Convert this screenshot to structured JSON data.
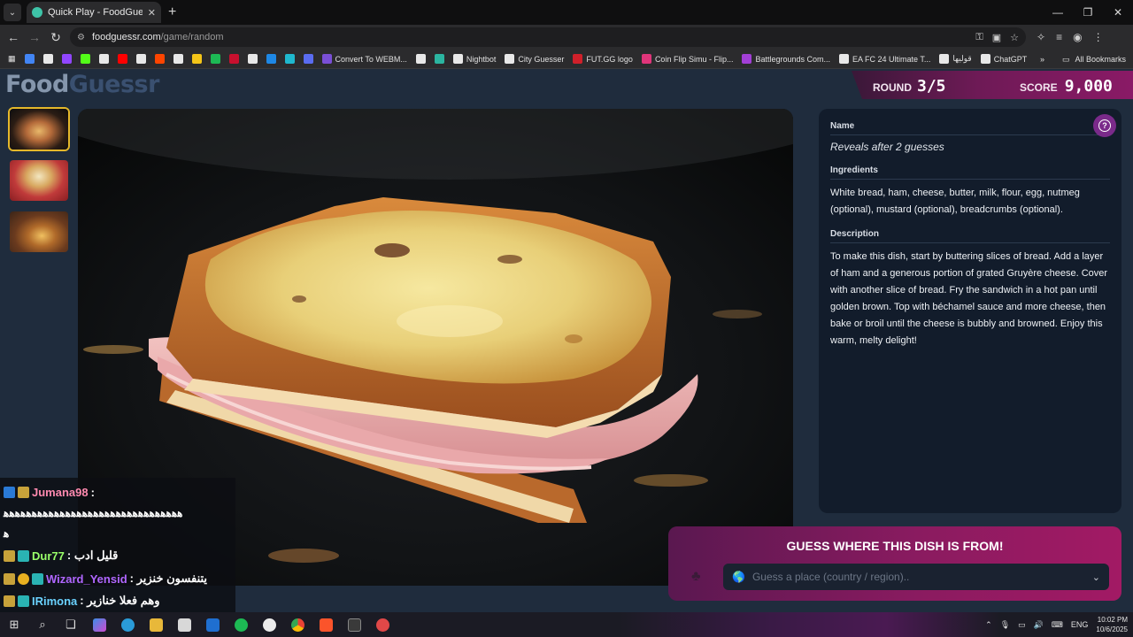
{
  "browser": {
    "tab_title": "Quick Play - FoodGuessr | Food",
    "url_host": "foodguessr.com",
    "url_path": "/game/random",
    "bookmarks": [
      {
        "label": "",
        "color": "#4285f4"
      },
      {
        "label": "",
        "color": "#e8e8e8"
      },
      {
        "label": "",
        "color": "#9146ff"
      },
      {
        "label": "",
        "color": "#53fc18"
      },
      {
        "label": "",
        "color": "#e8e8e8"
      },
      {
        "label": "",
        "color": "#ff0000"
      },
      {
        "label": "",
        "color": "#e8e8e8"
      },
      {
        "label": "",
        "color": "#ff4500"
      },
      {
        "label": "",
        "color": "#e8e8e8"
      },
      {
        "label": "",
        "color": "#f5c518"
      },
      {
        "label": "",
        "color": "#1db954"
      },
      {
        "label": "",
        "color": "#c8102e"
      },
      {
        "label": "",
        "color": "#e8e8e8"
      },
      {
        "label": "",
        "color": "#1e88e5"
      },
      {
        "label": "",
        "color": "#1fb8cd"
      },
      {
        "label": "",
        "color": "#5a6cf0"
      },
      {
        "label": "Convert To WEBM...",
        "color": "#7a4fd6"
      },
      {
        "label": "",
        "color": "#e8e8e8"
      },
      {
        "label": "",
        "color": "#2bb5a0"
      },
      {
        "label": "Nightbot",
        "color": "#e8e8e8"
      },
      {
        "label": "City Guesser",
        "color": "#e8e8e8"
      },
      {
        "label": "FUT.GG logo",
        "color": "#d0202a"
      },
      {
        "label": "Coin Flip Simu - Flip...",
        "color": "#e0357a"
      },
      {
        "label": "Battlegrounds Com...",
        "color": "#a23fd6"
      },
      {
        "label": "EA FC 24 Ultimate T...",
        "color": "#e8e8e8"
      },
      {
        "label": "قوليها",
        "color": "#e8e8e8"
      },
      {
        "label": "ChatGPT",
        "color": "#e8e8e8"
      }
    ],
    "all_bookmarks": "All Bookmarks"
  },
  "game": {
    "logo_part1": "Food",
    "logo_part2": "Guessr",
    "round_label": "ROUND",
    "round_value": "3/5",
    "score_label": "SCORE",
    "score_value": "9,000",
    "name_heading": "Name",
    "name_value": "Reveals after 2 guesses",
    "ingredients_heading": "Ingredients",
    "ingredients_text": "White bread, ham, cheese, butter, milk, flour, egg, nutmeg (optional), mustard (optional), breadcrumbs (optional).",
    "description_heading": "Description",
    "description_text": "To make this dish, start by buttering slices of bread. Add a layer of ham and a generous portion of grated Gruyère cheese. Cover with another slice of bread. Fry the sandwich in a hot pan until golden brown. Top with béchamel sauce and more cheese, then bake or broil until the cheese is bubbly and browned. Enjoy this warm, melty delight!",
    "guess_heading": "GUESS WHERE THIS DISH IS FROM!",
    "guess_placeholder": "Guess a place (country / region).."
  },
  "chat": [
    {
      "user": "Jumana98",
      "user_color": "#ff8ab0",
      "text": ":"
    },
    {
      "user": "",
      "user_color": "#ffffff",
      "text": "ﮬﮬﮬﮬﮬﮬﮬﮬﮬﮬﮬﮬﮬﮬﮬﮬﮬﮬﮬﮬﮬﮬﮬﮬﮬﮬﮬﮬﮬﮬﮬﮬ"
    },
    {
      "user": "",
      "user_color": "#ffffff",
      "text": "ﮬ"
    },
    {
      "user": "Dur77",
      "user_color": "#9aff6a",
      "text": ": قليل ادب"
    },
    {
      "user": "Wizard_Yensid",
      "user_color": "#b066ff",
      "text": ": يتنفسون خنزير"
    },
    {
      "user": "IRimona",
      "user_color": "#6ad2ff",
      "text": ": وهم فعلا خنازير"
    }
  ],
  "taskbar": {
    "lang": "ENG",
    "time": "10:02 PM",
    "date": "10/6/2025"
  }
}
